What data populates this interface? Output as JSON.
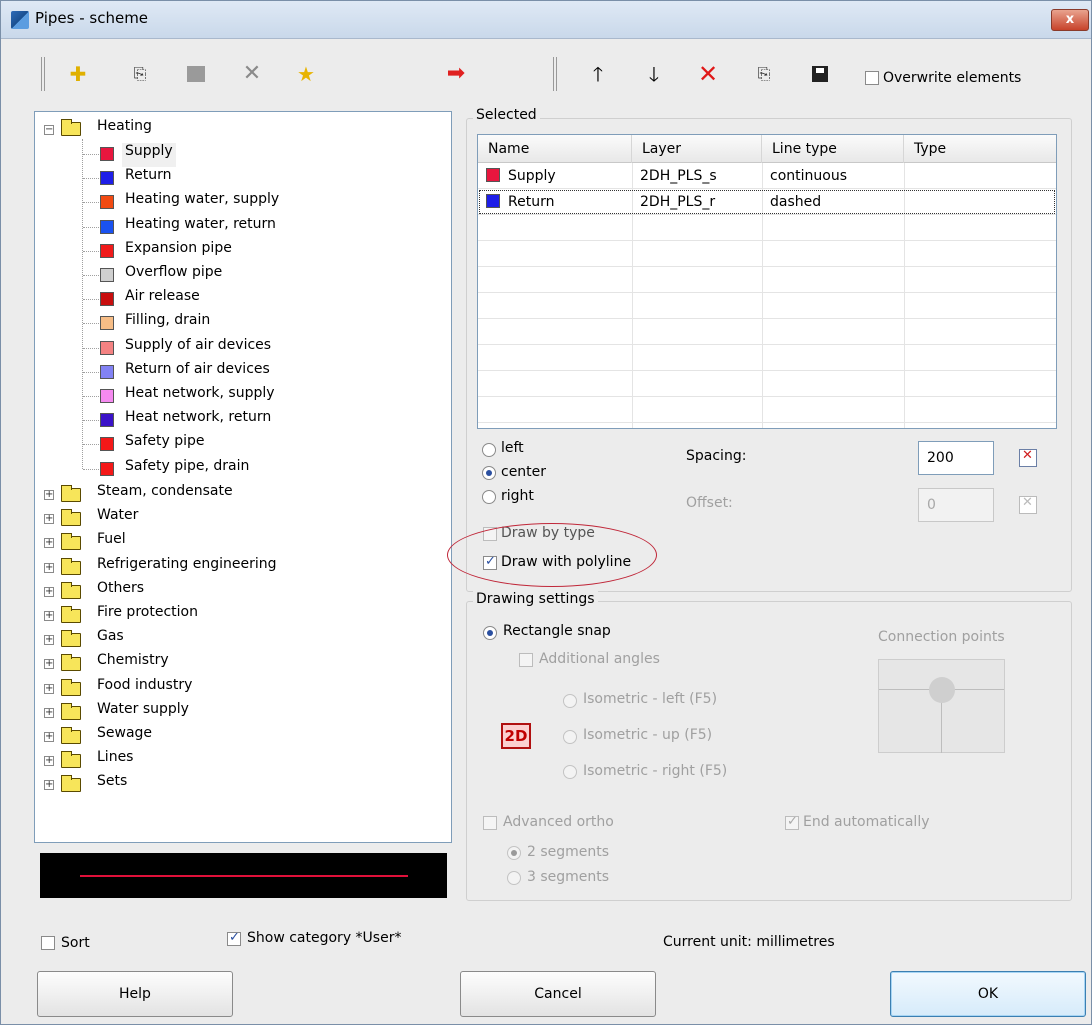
{
  "window": {
    "title": "Pipes - scheme",
    "close_label": "x"
  },
  "toolbar": {
    "overwrite_label": "Overwrite elements",
    "overwrite_checked": false
  },
  "tree": {
    "heating": {
      "label": "Heating",
      "children": [
        {
          "label": "Supply",
          "color": "#e8163e"
        },
        {
          "label": "Return",
          "color": "#1e1ee8"
        },
        {
          "label": "Heating water, supply",
          "color": "#f24a12"
        },
        {
          "label": "Heating water, return",
          "color": "#1a52f0"
        },
        {
          "label": "Expansion pipe",
          "color": "#f01a1a"
        },
        {
          "label": "Overflow pipe",
          "color": "#cfcfcf"
        },
        {
          "label": "Air release",
          "color": "#c80e0e"
        },
        {
          "label": "Filling, drain",
          "color": "#f7bd86"
        },
        {
          "label": "Supply of air devices",
          "color": "#f48282"
        },
        {
          "label": "Return of air devices",
          "color": "#8282f4"
        },
        {
          "label": "Heat network, supply",
          "color": "#f58af0"
        },
        {
          "label": "Heat network, return",
          "color": "#3a12c8"
        },
        {
          "label": "Safety pipe",
          "color": "#f41818"
        },
        {
          "label": "Safety pipe, drain",
          "color": "#f41818"
        }
      ]
    },
    "categories": [
      "Steam, condensate",
      "Water",
      "Fuel",
      "Refrigerating engineering",
      "Others",
      "Fire protection",
      "Gas",
      "Chemistry",
      "Food industry",
      "Water supply",
      "Sewage",
      "Lines",
      "Sets"
    ]
  },
  "selected": {
    "title": "Selected",
    "columns": [
      "Name",
      "Layer",
      "Line type",
      "Type"
    ],
    "rows": [
      {
        "name": "Supply",
        "layer": "2DH_PLS_s",
        "line_type": "continuous",
        "type": "",
        "color": "#e8163e"
      },
      {
        "name": "Return",
        "layer": "2DH_PLS_r",
        "line_type": "dashed",
        "type": "",
        "color": "#1e1ee8"
      }
    ]
  },
  "alignment": {
    "left": "left",
    "center": "center",
    "right": "right",
    "selected": "center"
  },
  "spacing": {
    "label": "Spacing:",
    "value": "200"
  },
  "offset": {
    "label": "Offset:",
    "value": "0"
  },
  "draw_by_type": {
    "label": "Draw by type",
    "checked": false
  },
  "draw_with_polyline": {
    "label": "Draw with polyline",
    "checked": true
  },
  "drawing_settings": {
    "title": "Drawing settings",
    "rectangle_snap": "Rectangle snap",
    "additional_angles": "Additional angles",
    "iso_left": "Isometric - left (F5)",
    "iso_up": "Isometric - up (F5)",
    "iso_right": "Isometric - right (F5)",
    "mode_badge": "2D",
    "connection_points": "Connection points",
    "advanced_ortho": "Advanced ortho",
    "end_automatically": "End automatically",
    "two_segments": "2 segments",
    "three_segments": "3 segments"
  },
  "footer": {
    "sort_label": "Sort",
    "sort_checked": false,
    "show_category_label": "Show category *User*",
    "show_category_checked": true,
    "current_unit": "Current unit: millimetres",
    "help": "Help",
    "cancel": "Cancel",
    "ok": "OK"
  },
  "preview_color": "#e0103a"
}
